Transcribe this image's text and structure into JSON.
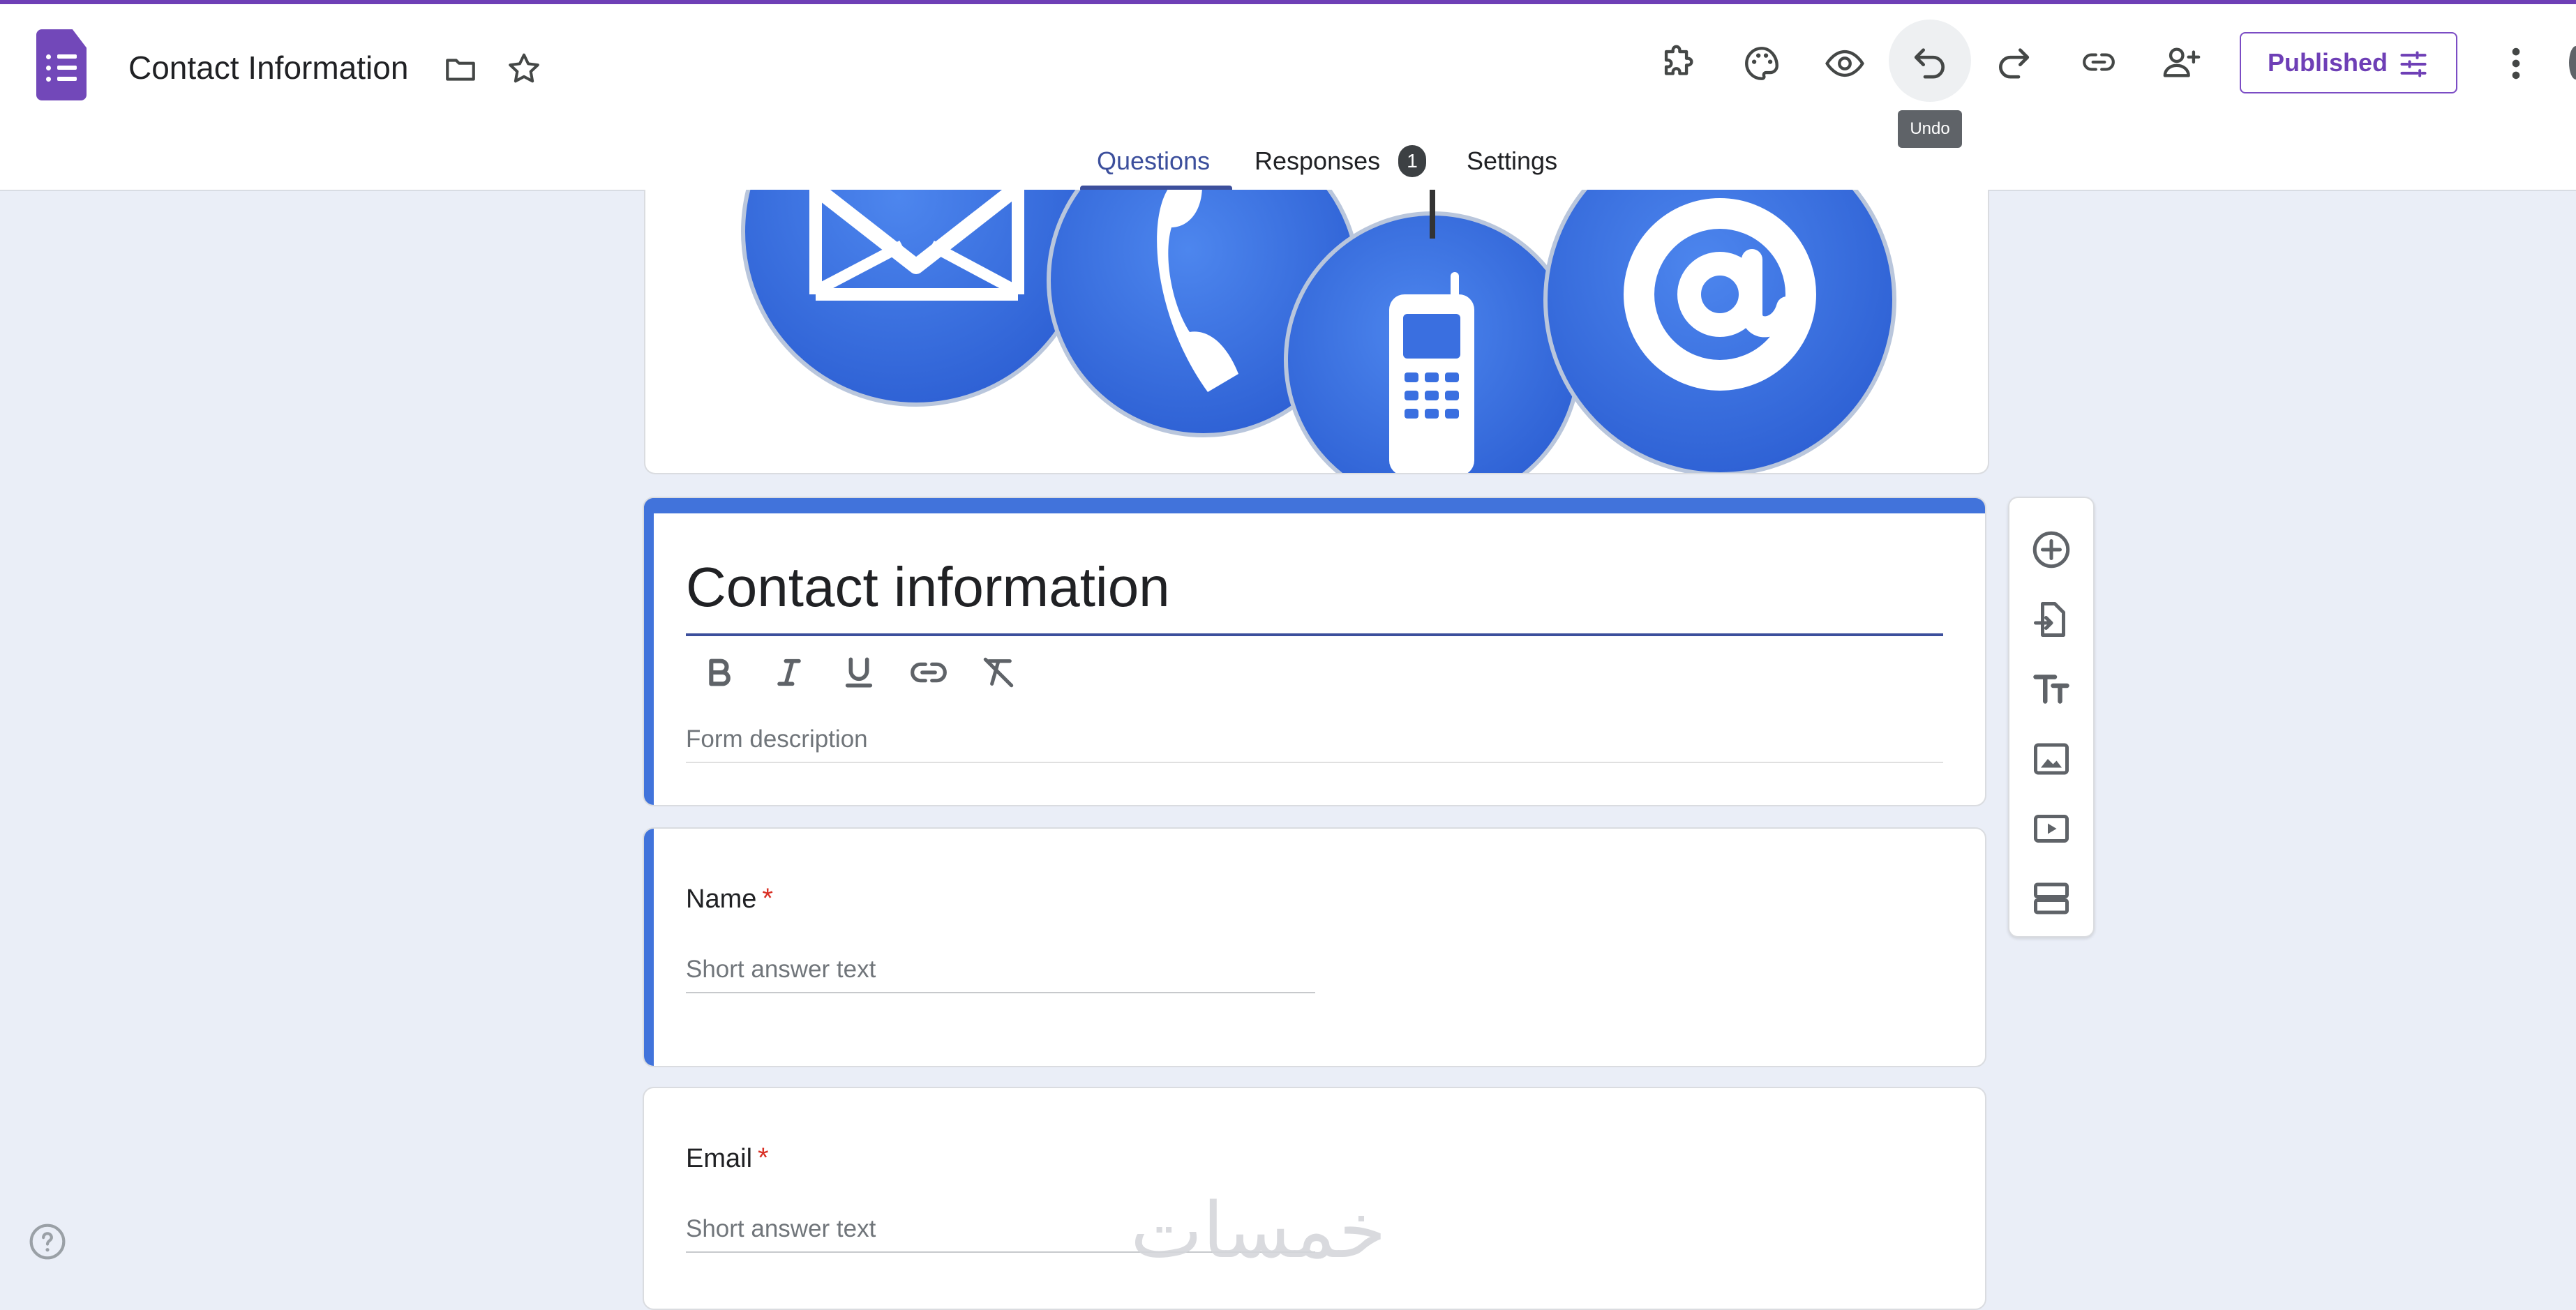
{
  "theme": {
    "accent": "#4173db",
    "brand_purple": "#7248b9",
    "tab_active": "#3c4f9c",
    "page_bg": "#eaeef7",
    "required": "#d93025"
  },
  "header": {
    "doc_title": "Contact Information",
    "icons": [
      "forms-logo-icon",
      "folder-icon",
      "star-icon",
      "addon-puzzle-icon",
      "palette-icon",
      "preview-eye-icon",
      "undo-icon",
      "redo-icon",
      "link-icon",
      "add-collaborator-icon",
      "tune-icon",
      "more-vert-icon"
    ],
    "tooltip": "Undo",
    "publish_button": "Published"
  },
  "tabs": [
    {
      "label": "Questions",
      "active": true
    },
    {
      "label": "Responses",
      "badge": "1"
    },
    {
      "label": "Settings"
    }
  ],
  "form": {
    "title": "Contact information",
    "description_placeholder": "Form description",
    "format_tools": [
      "bold-icon",
      "italic-icon",
      "underline-icon",
      "link-icon",
      "clear-format-icon"
    ]
  },
  "questions": [
    {
      "label": "Name",
      "required_mark": "*",
      "hint": "Short answer text"
    },
    {
      "label": "Email",
      "required_mark": "*",
      "hint": "Short answer text"
    }
  ],
  "side_toolbar": [
    "add-question-icon",
    "import-questions-icon",
    "add-title-icon",
    "add-image-icon",
    "add-video-icon",
    "add-section-icon"
  ],
  "watermark": "خمسات"
}
